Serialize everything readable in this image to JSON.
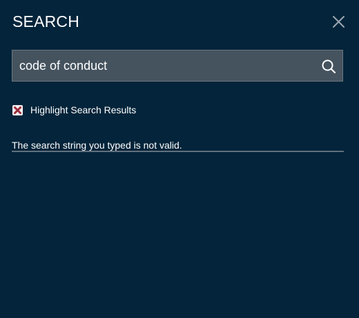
{
  "header": {
    "title": "SEARCH",
    "close_icon": "close-icon"
  },
  "search": {
    "value": "code of conduct",
    "icon": "search-icon"
  },
  "highlight_option": {
    "label": "Highlight Search Results",
    "checked": true,
    "mark_color": "#9b2b3a",
    "box_color": "#f4eef0"
  },
  "message": {
    "text": "The search string you typed is not valid."
  },
  "colors": {
    "background": "#03243a",
    "input_background": "#45535f",
    "rule": "#60707d"
  }
}
